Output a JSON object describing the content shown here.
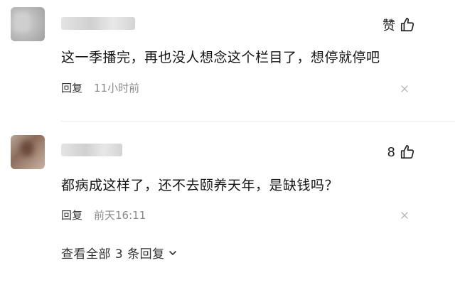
{
  "comments": [
    {
      "like_label": "赞",
      "text": "这一季播完，再也没人想念这个栏目了，想停就停吧",
      "reply_label": "回复",
      "time": "11小时前"
    },
    {
      "like_label": "8",
      "text": "都病成这样了，还不去颐养天年，是缺钱吗？",
      "reply_label": "回复",
      "time": "前天16:11"
    }
  ],
  "more_replies": {
    "label": "查看全部 3 条回复"
  },
  "icons": {
    "like": "thumbs-up-icon",
    "close": "close-icon",
    "expand": "chevron-down-icon"
  },
  "colors": {
    "text": "#151515",
    "muted": "#8a8a8a",
    "divider": "#ececec"
  }
}
